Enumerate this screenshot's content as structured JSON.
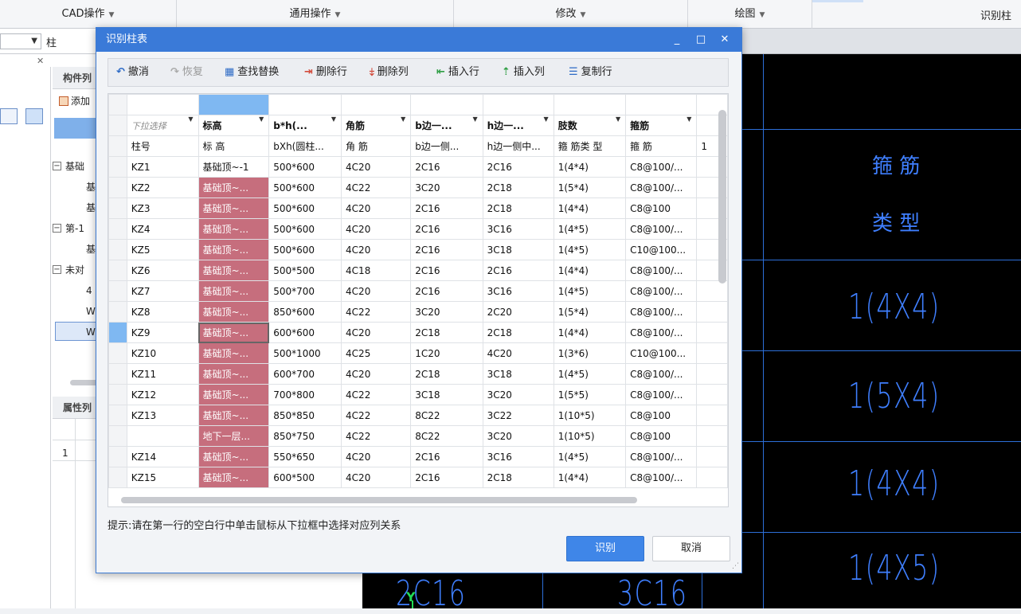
{
  "ribbon": {
    "groups": [
      "CAD操作",
      "通用操作",
      "修改",
      "绘图"
    ],
    "right_label": "识别柱"
  },
  "filter": {
    "combo_value": "柱"
  },
  "left_panel": {
    "component_list_title": "构件列",
    "add_label": "添加",
    "tree": [
      "基础",
      "基",
      "基",
      "第-1",
      "基",
      "未对",
      "4",
      "W",
      "W"
    ],
    "property_title": "属性列",
    "property_row": "1"
  },
  "cad": {
    "header_label_1": "箍 筋",
    "header_label_2": "类 型",
    "values": [
      "1(4X4)",
      "1(5X4)",
      "1(4X4)",
      "1(4X5)"
    ],
    "bottom_left": "2C16",
    "bottom_mid": "3C16",
    "axis_y": "Y"
  },
  "dialog": {
    "title": "识别柱表",
    "toolbar": {
      "undo": "撤消",
      "redo": "恢复",
      "find_replace": "查找替换",
      "delete_row": "删除行",
      "delete_col": "删除列",
      "insert_row": "插入行",
      "insert_col": "插入列",
      "copy_row": "复制行"
    },
    "dropdown_row": [
      "下拉选择",
      "标高",
      "b*h(...",
      "角筋",
      "b边一...",
      "h边一...",
      "肢数",
      "箍筋"
    ],
    "header_row": [
      "柱号",
      "标 高",
      "bXh(圆柱...",
      "角 筋",
      "b边一侧...",
      "h边一侧中...",
      "箍 筋类 型",
      "箍 筋",
      "1"
    ],
    "rows": [
      [
        "KZ1",
        "基础顶~-1",
        "500*600",
        "4C20",
        "2C16",
        "2C16",
        "1(4*4)",
        "C8@100/..."
      ],
      [
        "KZ2",
        "基础顶~...",
        "500*600",
        "4C22",
        "3C20",
        "2C18",
        "1(5*4)",
        "C8@100/..."
      ],
      [
        "KZ3",
        "基础顶~...",
        "500*600",
        "4C20",
        "2C16",
        "2C18",
        "1(4*4)",
        "C8@100"
      ],
      [
        "KZ4",
        "基础顶~...",
        "500*600",
        "4C20",
        "2C16",
        "3C16",
        "1(4*5)",
        "C8@100/..."
      ],
      [
        "KZ5",
        "基础顶~...",
        "500*600",
        "4C20",
        "2C16",
        "3C18",
        "1(4*5)",
        "C10@100..."
      ],
      [
        "KZ6",
        "基础顶~...",
        "500*500",
        "4C18",
        "2C16",
        "2C16",
        "1(4*4)",
        "C8@100/..."
      ],
      [
        "KZ7",
        "基础顶~...",
        "500*700",
        "4C20",
        "2C16",
        "3C16",
        "1(4*5)",
        "C8@100/..."
      ],
      [
        "KZ8",
        "基础顶~...",
        "850*600",
        "4C22",
        "3C20",
        "2C20",
        "1(5*4)",
        "C8@100/..."
      ],
      [
        "KZ9",
        "基础顶~...",
        "600*600",
        "4C20",
        "2C18",
        "2C18",
        "1(4*4)",
        "C8@100/..."
      ],
      [
        "KZ10",
        "基础顶~...",
        "500*1000",
        "4C25",
        "1C20",
        "4C20",
        "1(3*6)",
        "C10@100..."
      ],
      [
        "KZ11",
        "基础顶~...",
        "600*700",
        "4C20",
        "2C18",
        "3C18",
        "1(4*5)",
        "C8@100/..."
      ],
      [
        "KZ12",
        "基础顶~...",
        "700*800",
        "4C22",
        "3C18",
        "3C20",
        "1(5*5)",
        "C8@100/..."
      ],
      [
        "KZ13",
        "基础顶~...",
        "850*850",
        "4C22",
        "8C22",
        "3C22",
        "1(10*5)",
        "C8@100"
      ],
      [
        "",
        "地下一层...",
        "850*750",
        "4C22",
        "8C22",
        "3C20",
        "1(10*5)",
        "C8@100"
      ],
      [
        "KZ14",
        "基础顶~...",
        "550*650",
        "4C20",
        "2C16",
        "3C16",
        "1(4*5)",
        "C8@100/..."
      ],
      [
        "KZ15",
        "基础顶~...",
        "600*500",
        "4C20",
        "2C16",
        "2C18",
        "1(4*4)",
        "C8@100/..."
      ]
    ],
    "hint": "提示:请在第一行的空白行中单击鼠标从下拉框中选择对应列关系",
    "ok_label": "识别",
    "cancel_label": "取消"
  }
}
